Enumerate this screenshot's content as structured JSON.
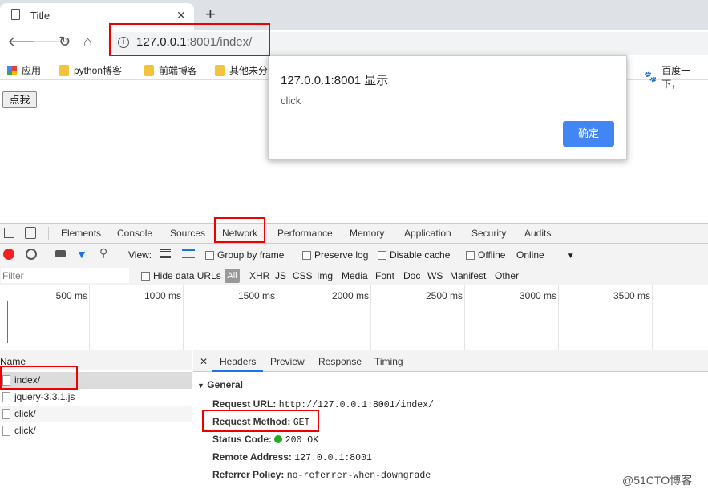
{
  "browser": {
    "tab_title": "Title",
    "tab_close": "✕",
    "new_tab": "+",
    "url_host": "127.0.0.1",
    "url_rest": ":8001/index/",
    "bookmarks": [
      "应用",
      "python博客",
      "前端博客",
      "其他未分",
      "百度一下，"
    ]
  },
  "page": {
    "button_label": "点我"
  },
  "dialog": {
    "title": "127.0.0.1:8001 显示",
    "message": "click",
    "ok_label": "确定"
  },
  "devtools": {
    "tabs": [
      "Elements",
      "Console",
      "Sources",
      "Network",
      "Performance",
      "Memory",
      "Application",
      "Security",
      "Audits"
    ],
    "active_tab": "Network",
    "toolbar": {
      "view_label": "View:",
      "group_by_frame": "Group by frame",
      "preserve_log": "Preserve log",
      "disable_cache": "Disable cache",
      "offline": "Offline",
      "throttle": "Online"
    },
    "filter": {
      "placeholder": "Filter",
      "hide_data_urls": "Hide data URLs",
      "types": [
        "All",
        "XHR",
        "JS",
        "CSS",
        "Img",
        "Media",
        "Font",
        "Doc",
        "WS",
        "Manifest",
        "Other"
      ]
    },
    "timeline_ticks": [
      "500 ms",
      "1000 ms",
      "1500 ms",
      "2000 ms",
      "2500 ms",
      "3000 ms",
      "3500 ms"
    ],
    "requests": {
      "header": "Name",
      "items": [
        "index/",
        "jquery-3.3.1.js",
        "click/",
        "click/"
      ]
    },
    "detail": {
      "close": "✕",
      "tabs": [
        "Headers",
        "Preview",
        "Response",
        "Timing"
      ],
      "active_tab": "Headers",
      "section": "General",
      "rows": [
        {
          "label": "Request URL:",
          "value": "http://127.0.0.1:8001/index/"
        },
        {
          "label": "Request Method:",
          "value": "GET"
        },
        {
          "label": "Status Code:",
          "value": "200 OK"
        },
        {
          "label": "Remote Address:",
          "value": "127.0.0.1:8001"
        },
        {
          "label": "Referrer Policy:",
          "value": "no-referrer-when-downgrade"
        }
      ]
    }
  },
  "watermark": "@51CTO博客",
  "colors": {
    "accent": "#4285f4",
    "highlight": "#e00000",
    "status_ok": "#22aa22"
  }
}
